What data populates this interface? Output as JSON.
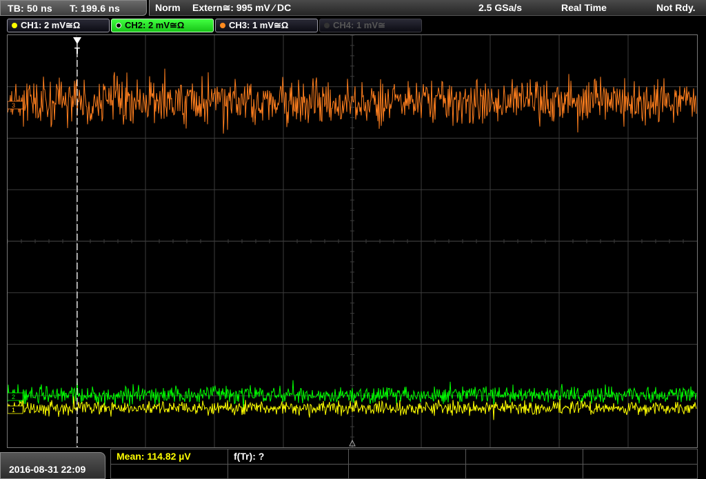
{
  "header": {
    "timebase": "TB: 50 ns",
    "trigger_time": "T: 199.6 ns",
    "trigger_mode": "Norm",
    "trigger_source": "Extern≅: 995 mV ⁄ DC",
    "sample_rate": "2.5 GSa/s",
    "acq_mode": "Real Time",
    "state": "Not Rdy."
  },
  "channels": [
    {
      "label": "CH1: 2 mV≅Ω",
      "color": "#ffff00",
      "state": "on"
    },
    {
      "label": "CH2: 2 mV≅Ω",
      "color": "#00ff00",
      "state": "selected"
    },
    {
      "label": "CH3: 1 mV≅Ω",
      "color": "#ff8a1f",
      "state": "on"
    },
    {
      "label": "CH4: 1 mV≅",
      "color": "#555555",
      "state": "off"
    }
  ],
  "markers": {
    "trigger": "T",
    "ch3": "3",
    "ch1": "1",
    "ch2": "2"
  },
  "measurements": {
    "mean": "Mean: 114.82 µV",
    "freq": "f(Tr): ?"
  },
  "datetime": "2016-08-31 22:09",
  "colors": {
    "grid": "#3c3c3c",
    "ch1": "#ffff00",
    "ch2": "#00ff00",
    "ch3": "#ff7f1e",
    "meas_text": "#ffff00"
  }
}
